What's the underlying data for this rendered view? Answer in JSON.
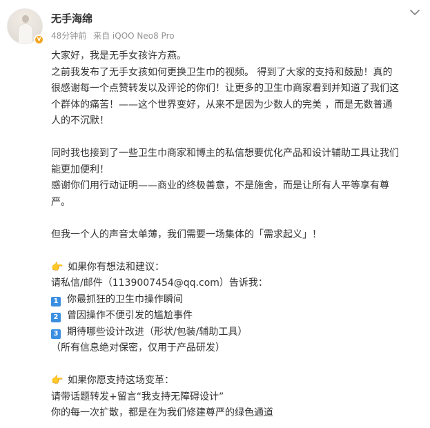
{
  "author": {
    "name": "无手海绵",
    "verified_mark": "v"
  },
  "meta": {
    "time": "48分钟前",
    "source": "来自 iQOO Neo8 Pro"
  },
  "icons": {
    "avatar": "avatar-image",
    "menu": "chevron-down-icon",
    "pointing": "pointing-hand-icon",
    "colors": {
      "number_badge": "#3b8fe0",
      "verified": "#f5a623",
      "hand": "#f2b53a"
    }
  },
  "post": {
    "lines": [
      "大家好，我是无手女孩许方燕。",
      "之前我发布了无手女孩如何更换卫生巾的视频。 得到了大家的支持和鼓励！真的",
      "很感谢每一个点赞转发以及评论的你们！让更多的卫生巾商家看到并知道了我们这",
      "个群体的痛苦！——这个世界变好，从来不是因为少数人的完美 ，而是无数普通",
      "人的不沉默！",
      "",
      "同时我也接到了一些卫生巾商家和博主的私信想要优化产品和设计辅助工具让我们",
      "能更加便利！",
      "感谢你们用行动证明——商业的终极善意，不是施舍，而是让所有人平等享有尊",
      "严。",
      "",
      "但我一个人的声音太单薄，我们需要一场集体的「需求起义」！",
      ""
    ],
    "section1": {
      "icon": "👉",
      "heading": "如果你有想法和建议：",
      "contact": "请私信/邮件（1139007454@qq.com）告诉我：",
      "items": [
        {
          "num": "1",
          "text": "你最抓狂的卫生巾操作瞬间"
        },
        {
          "num": "2",
          "text": "曾因操作不便引发的尴尬事件"
        },
        {
          "num": "3",
          "text": "期待哪些设计改进（形状/包装/辅助工具）"
        }
      ],
      "note": "（所有信息绝对保密，仅用于产品研发）"
    },
    "section2": {
      "icon": "👉",
      "heading": "如果你愿支持这场变革：",
      "action": "请带话题转发+留言“我支持无障碍设计”",
      "closing": "你的每一次扩散，都是在为我们修建尊严的绿色通道"
    }
  }
}
